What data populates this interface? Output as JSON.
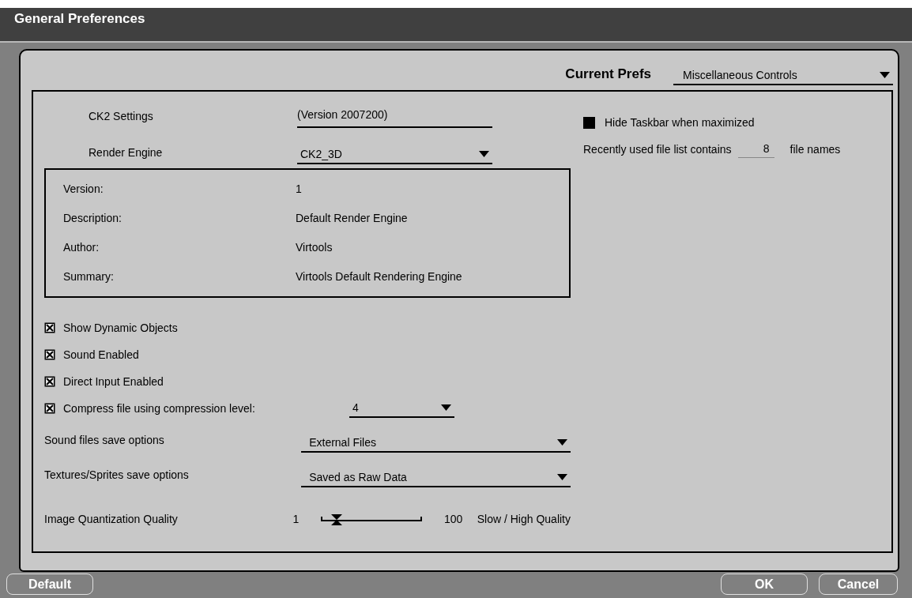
{
  "window": {
    "title": "General Preferences"
  },
  "current_prefs": {
    "label": "Current Prefs",
    "value": "Miscellaneous Controls"
  },
  "ck2_settings": {
    "label": "CK2 Settings",
    "version": "(Version 2007200)"
  },
  "render_engine": {
    "label": "Render Engine",
    "value": "CK2_3D"
  },
  "engine_info": [
    {
      "label": "Version:",
      "value": "1"
    },
    {
      "label": "Description:",
      "value": "Default Render Engine"
    },
    {
      "label": "Author:",
      "value": "Virtools"
    },
    {
      "label": "Summary:",
      "value": "Virtools Default Rendering Engine"
    }
  ],
  "hide_taskbar": {
    "label": "Hide Taskbar when maximized",
    "checked": false
  },
  "recent_files": {
    "label": "Recently used file list contains",
    "value": "8",
    "suffix": "file names"
  },
  "checkboxes": [
    {
      "label": "Show Dynamic Objects",
      "checked": true
    },
    {
      "label": "Sound Enabled",
      "checked": true
    },
    {
      "label": "Direct Input Enabled",
      "checked": true
    },
    {
      "label": "Compress file using compression level:",
      "checked": true,
      "dropdown": "4"
    }
  ],
  "save_options": [
    {
      "label": "Sound files save options",
      "value": "External Files"
    },
    {
      "label": "Textures/Sprites save options",
      "value": "Saved as Raw Data"
    }
  ],
  "quantization": {
    "label": "Image Quantization Quality",
    "min": "1",
    "max": "100",
    "level": 0.16,
    "note": "Slow / High Quality"
  },
  "buttons": {
    "left": [
      "Default"
    ],
    "right": [
      "OK",
      "Cancel"
    ]
  }
}
